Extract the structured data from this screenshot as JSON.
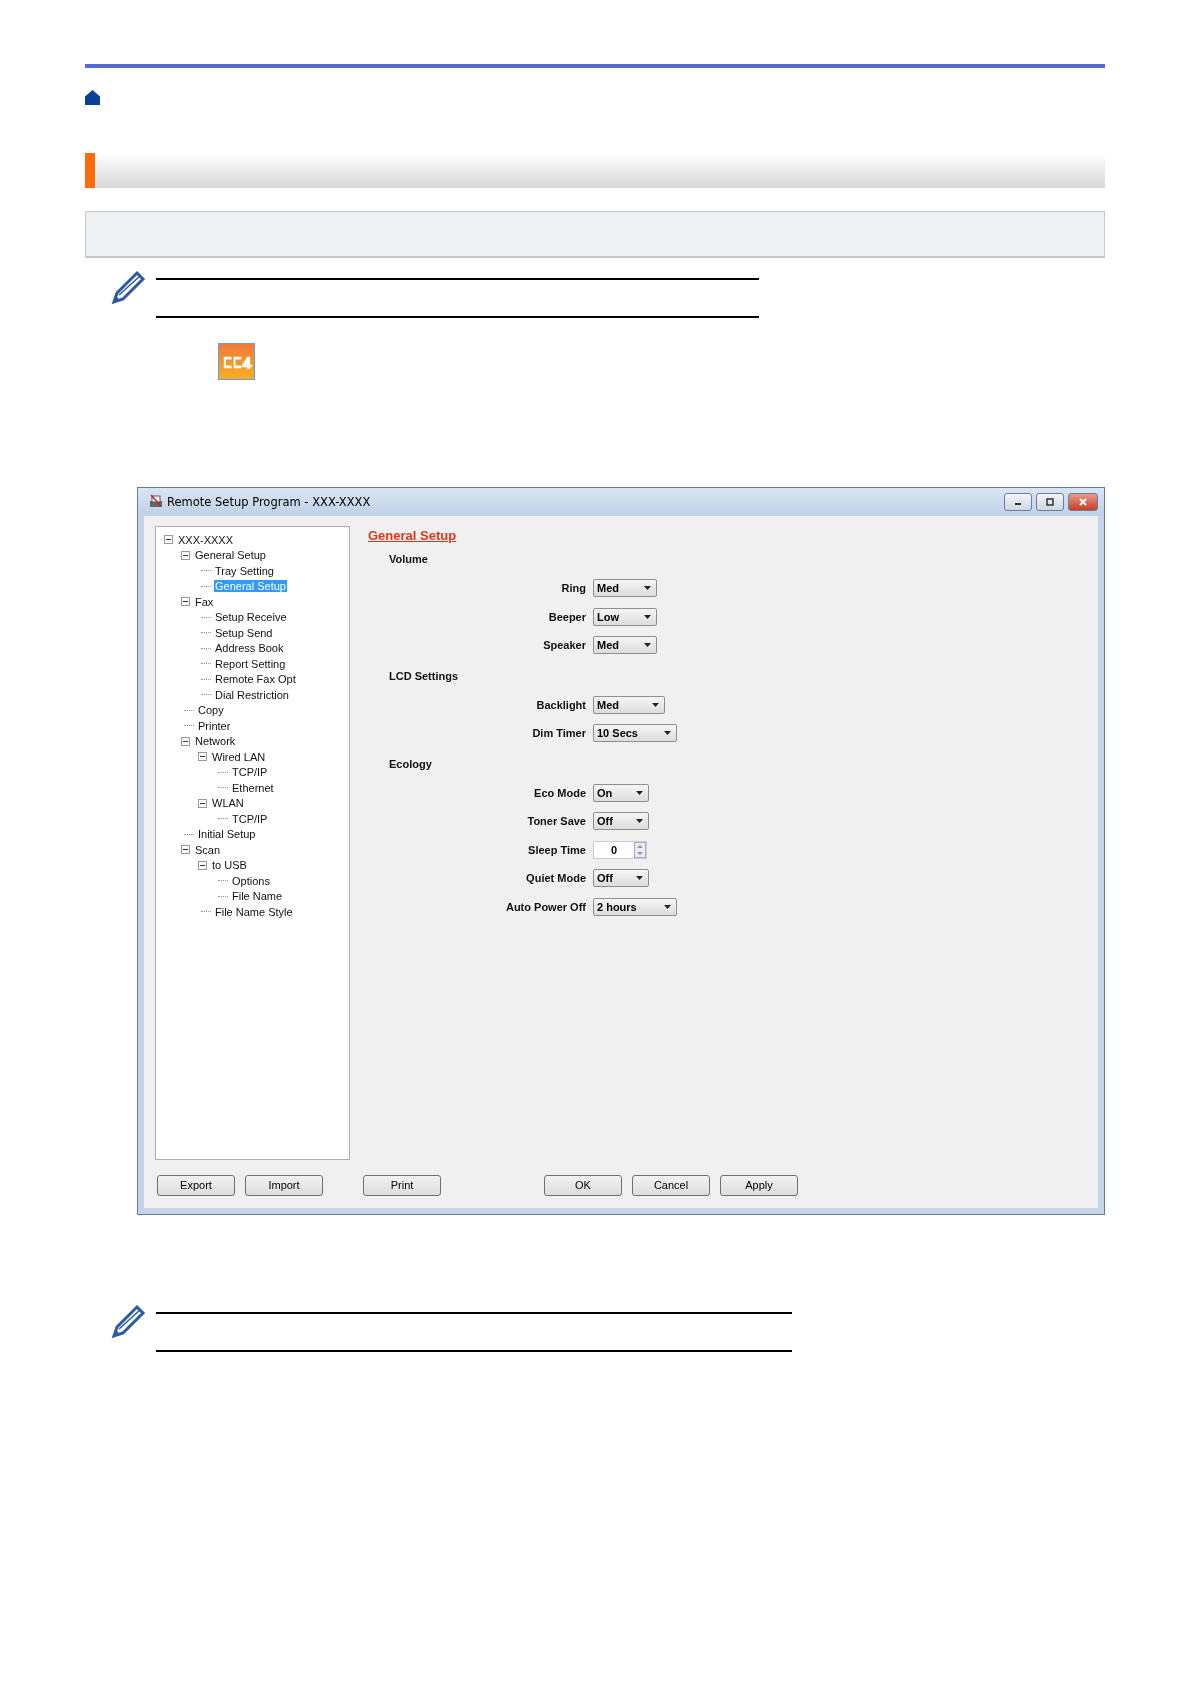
{
  "window": {
    "title": "Remote Setup Program - XXX-XXXX"
  },
  "tree": [
    {
      "label": "XXX-XXXX",
      "expanded": true,
      "selected": false,
      "children": [
        {
          "label": "General Setup",
          "expanded": true,
          "selected": false,
          "children": [
            {
              "label": "Tray Setting",
              "selected": false
            },
            {
              "label": "General Setup",
              "selected": true
            }
          ]
        },
        {
          "label": "Fax",
          "expanded": true,
          "selected": false,
          "children": [
            {
              "label": "Setup Receive",
              "selected": false
            },
            {
              "label": "Setup Send",
              "selected": false
            },
            {
              "label": "Address Book",
              "selected": false
            },
            {
              "label": "Report Setting",
              "selected": false
            },
            {
              "label": "Remote Fax Opt",
              "selected": false
            },
            {
              "label": "Dial Restriction",
              "selected": false
            }
          ]
        },
        {
          "label": "Copy",
          "selected": false
        },
        {
          "label": "Printer",
          "selected": false
        },
        {
          "label": "Network",
          "expanded": true,
          "selected": false,
          "children": [
            {
              "label": "Wired LAN",
              "expanded": true,
              "selected": false,
              "children": [
                {
                  "label": "TCP/IP",
                  "selected": false
                },
                {
                  "label": "Ethernet",
                  "selected": false
                }
              ]
            },
            {
              "label": "WLAN",
              "expanded": true,
              "selected": false,
              "children": [
                {
                  "label": "TCP/IP",
                  "selected": false
                }
              ]
            }
          ]
        },
        {
          "label": "Initial Setup",
          "selected": false
        },
        {
          "label": "Scan",
          "expanded": true,
          "selected": false,
          "children": [
            {
              "label": "to USB",
              "expanded": true,
              "selected": false,
              "children": [
                {
                  "label": "Options",
                  "selected": false
                },
                {
                  "label": "File Name",
                  "selected": false
                }
              ]
            },
            {
              "label": "File Name Style",
              "selected": false
            }
          ]
        }
      ]
    }
  ],
  "panel": {
    "heading": "General Setup",
    "settings": [
      {
        "kind": "header",
        "label": "Volume"
      },
      {
        "kind": "dropdown",
        "label": "Ring",
        "value": "Med"
      },
      {
        "kind": "dropdown",
        "label": "Beeper",
        "value": "Low"
      },
      {
        "kind": "dropdown",
        "label": "Speaker",
        "value": "Med"
      },
      {
        "kind": "header",
        "label": "LCD Settings"
      },
      {
        "kind": "dropdown",
        "label": "Backlight",
        "value": "Med"
      },
      {
        "kind": "dropdown",
        "label": "Dim Timer",
        "value": "10 Secs"
      },
      {
        "kind": "header",
        "label": "Ecology"
      },
      {
        "kind": "dropdown",
        "label": "Eco Mode",
        "value": "On"
      },
      {
        "kind": "dropdown",
        "label": "Toner Save",
        "value": "Off"
      },
      {
        "kind": "spinner",
        "label": "Sleep Time",
        "value": "0"
      },
      {
        "kind": "dropdown",
        "label": "Quiet Mode",
        "value": "Off"
      },
      {
        "kind": "dropdown",
        "label": "Auto Power Off",
        "value": "2 hours"
      }
    ]
  },
  "buttons": [
    "Export",
    "Import",
    "Print",
    "OK",
    "Cancel",
    "Apply"
  ]
}
